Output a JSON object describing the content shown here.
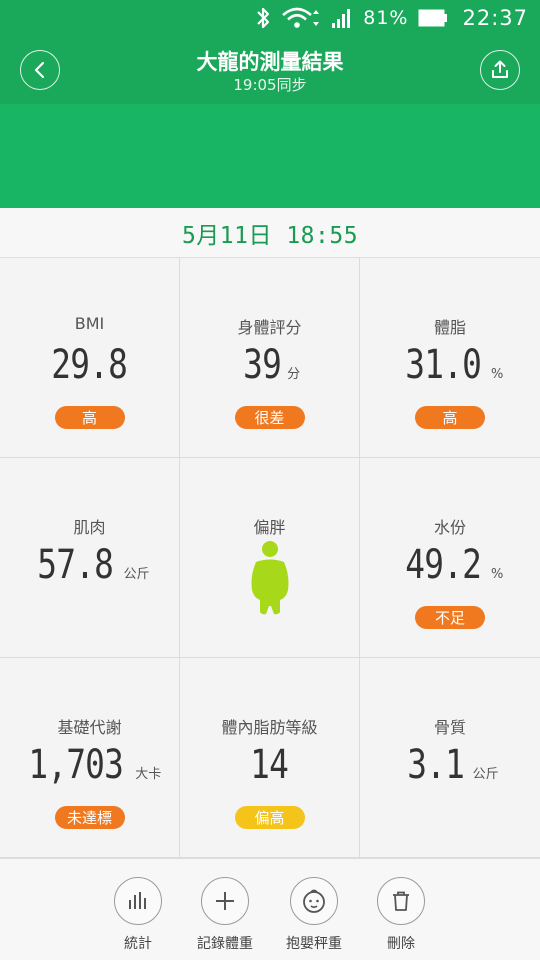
{
  "status_bar": {
    "battery": "81%",
    "time": "22:37"
  },
  "header": {
    "title": "大龍的測量結果",
    "subtitle": "19:05同步"
  },
  "date": "5月11日 18:55",
  "metrics": [
    {
      "label": "BMI",
      "value": "29.8",
      "unit": "",
      "badge": "高",
      "badge_color": "#f0781e"
    },
    {
      "label": "身體評分",
      "value": "39",
      "unit": "分",
      "badge": "很差",
      "badge_color": "#f0781e"
    },
    {
      "label": "體脂",
      "value": "31.0",
      "unit": "%",
      "badge": "高",
      "badge_color": "#f0781e"
    },
    {
      "label": "肌肉",
      "value": "57.8",
      "unit": "公斤"
    },
    {
      "label": "偏胖",
      "figure": "body-figure-icon",
      "figure_color": "#a8d81a"
    },
    {
      "label": "水份",
      "value": "49.2",
      "unit": "%",
      "badge": "不足",
      "badge_color": "#f0781e"
    },
    {
      "label": "基礎代謝",
      "value": "1,703",
      "unit": "大卡",
      "badge": "未達標",
      "badge_color": "#f0781e"
    },
    {
      "label": "體內脂肪等級",
      "value": "14",
      "unit": "",
      "badge": "偏高",
      "badge_color": "#f5c41a"
    },
    {
      "label": "骨質",
      "value": "3.1",
      "unit": "公斤"
    }
  ],
  "actions": [
    {
      "label": "統計",
      "icon": "bar-chart-icon"
    },
    {
      "label": "記錄體重",
      "icon": "plus-icon"
    },
    {
      "label": "抱嬰秤重",
      "icon": "baby-face-icon"
    },
    {
      "label": "刪除",
      "icon": "trash-icon"
    }
  ]
}
